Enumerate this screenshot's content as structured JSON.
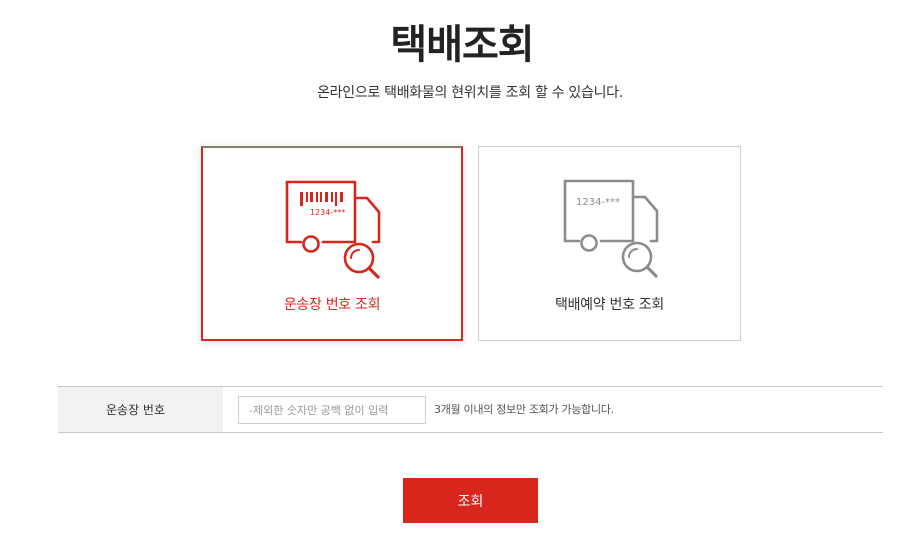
{
  "header": {
    "title": "택배조회",
    "subtitle": "온라인으로 택배화물의 현위치를 조회 할 수 있습니다."
  },
  "options": [
    {
      "label": "운송장 번호 조회",
      "icon": "truck-barcode-search-icon",
      "selected": true,
      "icon_text": "1234-***"
    },
    {
      "label": "택배예약 번호 조회",
      "icon": "truck-reservation-search-icon",
      "selected": false,
      "icon_text": "1234-***"
    }
  ],
  "form": {
    "label": "운송장 번호",
    "input_value": "",
    "input_placeholder": "-제외한 숫자만 공백 없이 입력",
    "help": "3개월 이내의 정보만 조회가 가능합니다."
  },
  "submit_label": "조회",
  "colors": {
    "accent": "#d9261c",
    "inactive_icon": "#8c8c8c"
  }
}
